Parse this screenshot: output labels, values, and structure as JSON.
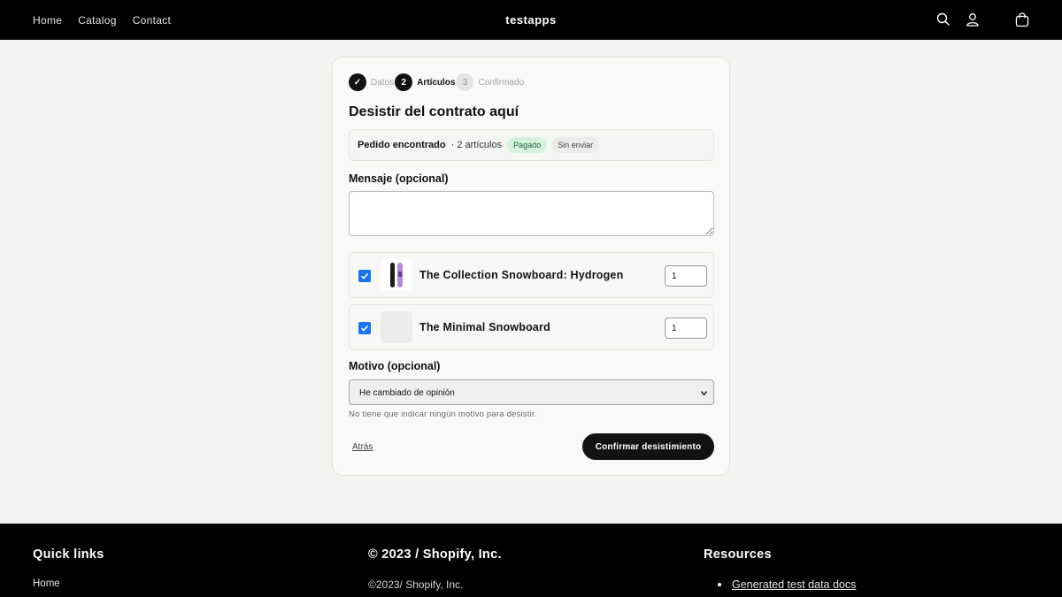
{
  "header": {
    "nav": [
      "Home",
      "Catalog",
      "Contact"
    ],
    "brand": "testapps",
    "icons": [
      "search-icon",
      "account-icon",
      "cart-icon"
    ]
  },
  "stepper": {
    "steps": [
      {
        "marker": "✓",
        "label": "Datos",
        "state": "done"
      },
      {
        "marker": "2",
        "label": "Artículos",
        "state": "active"
      },
      {
        "marker": "3",
        "label": "Confirmado",
        "state": "pending"
      }
    ]
  },
  "form": {
    "title": "Desistir del contrato aquí",
    "order": {
      "found": "Pedido encontrado",
      "count": "· 2 artículos",
      "badge_paid": "Pagado",
      "badge_fulfillment": "Sin enviar"
    },
    "message_label": "Mensaje (opcional)",
    "message_value": "",
    "items": [
      {
        "name": "The Collection Snowboard: Hydrogen",
        "qty": "1",
        "checked": true
      },
      {
        "name": "The Minimal Snowboard",
        "qty": "1",
        "checked": true
      }
    ],
    "reason_label": "Motivo (opcional)",
    "reason_selected": "He cambiado de opinión",
    "reason_hint": "No tiene que indicar ningún motivo para desistir.",
    "back_label": "Atrás",
    "confirm_label": "Confirmar desistimiento"
  },
  "footer": {
    "quick_links": {
      "heading": "Quick links",
      "items": [
        "Home"
      ]
    },
    "copyright": {
      "heading": "© 2023 / Shopify, Inc.",
      "text": "©2023/ Shopify, Inc."
    },
    "resources": {
      "heading": "Resources",
      "items": [
        "Generated test data docs"
      ]
    }
  },
  "colors": {
    "accent": "#121212",
    "checkbox": "#1a73e8",
    "paid_bg": "#d6f2de",
    "paid_text": "#26683b"
  }
}
